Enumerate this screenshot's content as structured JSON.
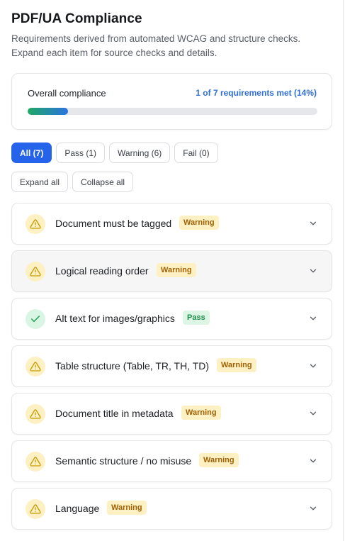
{
  "header": {
    "title": "PDF/UA Compliance",
    "subtitle": "Requirements derived from automated WCAG and structure checks. Expand each item for source checks and details."
  },
  "overall": {
    "label": "Overall compliance",
    "stat": "1 of 7 requirements met (14%)",
    "progress_fraction": 0.14
  },
  "filters": [
    {
      "label": "All (7)",
      "active": true
    },
    {
      "label": "Pass (1)",
      "active": false
    },
    {
      "label": "Warning (6)",
      "active": false
    },
    {
      "label": "Fail (0)",
      "active": false
    }
  ],
  "actions": {
    "expand_all": "Expand all",
    "collapse_all": "Collapse all"
  },
  "requirements": [
    {
      "label": "Document must be tagged",
      "status": "Warning",
      "icon": "warning-icon"
    },
    {
      "label": "Logical reading order",
      "status": "Warning",
      "icon": "warning-icon"
    },
    {
      "label": "Alt text for images/graphics",
      "status": "Pass",
      "icon": "check-icon"
    },
    {
      "label": "Table structure (Table, TR, TH, TD)",
      "status": "Warning",
      "icon": "warning-icon"
    },
    {
      "label": "Document title in metadata",
      "status": "Warning",
      "icon": "warning-icon"
    },
    {
      "label": "Semantic structure / no misuse",
      "status": "Warning",
      "icon": "warning-icon"
    },
    {
      "label": "Language",
      "status": "Warning",
      "icon": "warning-icon"
    }
  ],
  "colors": {
    "accent": "#2563eb",
    "warning_bg": "#fdf0c2",
    "warning_text": "#a16207",
    "pass_bg": "#dcf5e5",
    "pass_text": "#1e8a4c"
  }
}
